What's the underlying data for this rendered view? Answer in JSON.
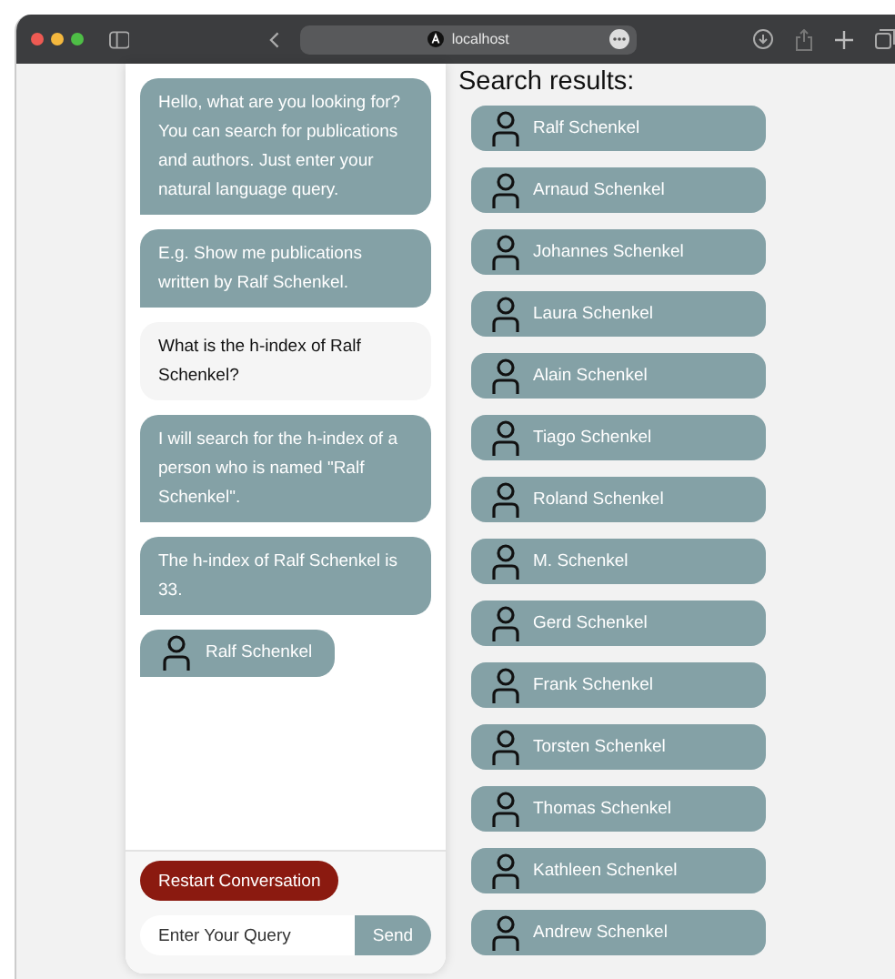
{
  "browser": {
    "address": "localhost"
  },
  "chat": {
    "messages": [
      {
        "kind": "bot",
        "text": "Hello, what are you looking for? You can search for publications and authors. Just enter your natural language query."
      },
      {
        "kind": "bot",
        "text": "E.g. Show me publications written by Ralf Schenkel."
      },
      {
        "kind": "user",
        "text": "What is the h-index of Ralf Schenkel?"
      },
      {
        "kind": "bot",
        "text": "I will search for the h-index of a person who is named \"Ralf Schenkel\"."
      },
      {
        "kind": "bot",
        "text": "The h-index of Ralf Schenkel is 33."
      },
      {
        "kind": "person",
        "text": "Ralf Schenkel"
      }
    ],
    "restart_button": "Restart Conversation",
    "query": {
      "placeholder": "Enter Your Query"
    },
    "send_button": "Send"
  },
  "results": {
    "heading": "Search results:",
    "items": [
      "Ralf Schenkel",
      "Arnaud Schenkel",
      "Johannes Schenkel",
      "Laura Schenkel",
      "Alain Schenkel",
      "Tiago Schenkel",
      "Roland Schenkel",
      "M. Schenkel",
      "Gerd Schenkel",
      "Frank Schenkel",
      "Torsten Schenkel",
      "Thomas Schenkel",
      "Kathleen Schenkel",
      "Andrew Schenkel"
    ]
  }
}
